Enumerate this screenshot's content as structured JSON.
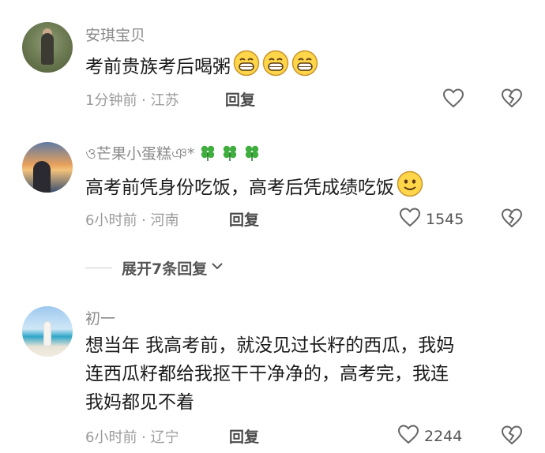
{
  "comments": [
    {
      "username": "安琪宝贝",
      "text": "考前贵族考后喝粥",
      "meta": "1分钟前 · 江苏",
      "reply_label": "回复",
      "likes": ""
    },
    {
      "username": "ও芒果小蛋糕ঞ*",
      "text": "高考前凭身份吃饭，高考后凭成绩吃饭",
      "meta": "6小时前 · 河南",
      "reply_label": "回复",
      "likes": "1545"
    },
    {
      "username": "初一",
      "text_lines": [
        "想当年 我高考前，就没见过长籽的西瓜，我妈",
        "连西瓜籽都给我抠干干净净的，高考完，我连",
        "我妈都见不着"
      ],
      "meta": "6小时前 · 辽宁",
      "reply_label": "回复",
      "likes": "2244"
    }
  ],
  "expand_replies": {
    "label": "展开7条回复"
  },
  "icons": {
    "like": "heart-outline-icon",
    "dislike": "broken-heart-icon",
    "emoji": "grinning-face-emoji",
    "clover": "four-leaf-clover-emoji",
    "expand": "chevron-down-icon"
  },
  "colors": {
    "username": "#8a8a8a",
    "text": "#1b1b1b",
    "meta": "#9a9a9a"
  }
}
